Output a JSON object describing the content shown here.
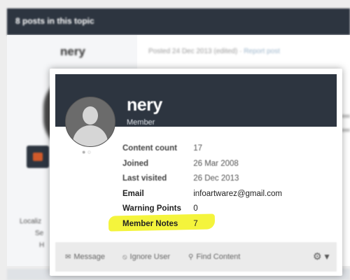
{
  "topic_header": {
    "title": "8 posts in this topic"
  },
  "post": {
    "author": "nery",
    "posted": "Posted 24 Dec 2013 (edited) ·",
    "report_link": "Report post",
    "side_lines": [
      "Localiz",
      "Se",
      "H"
    ]
  },
  "hovercard": {
    "name": "nery",
    "group": "Member",
    "presence": "● ○",
    "stats": [
      {
        "label": "Content count",
        "value": "17"
      },
      {
        "label": "Joined",
        "value": "26 Mar 2008"
      },
      {
        "label": "Last visited",
        "value": "26 Dec 2013"
      },
      {
        "label": "Email",
        "value": "infoartwarez@gmail.com"
      },
      {
        "label": "Warning Points",
        "value": "0"
      },
      {
        "label": "Member Notes",
        "value": "7"
      }
    ],
    "footer": {
      "message_label": "Message",
      "ignore_label": "Ignore User",
      "find_label": "Find Content",
      "gear_label": "⚙ ▾"
    }
  },
  "colors": {
    "header_bg": "#2d3540",
    "highlight": "#f4f43c",
    "footer_bg": "#ebebeb"
  }
}
